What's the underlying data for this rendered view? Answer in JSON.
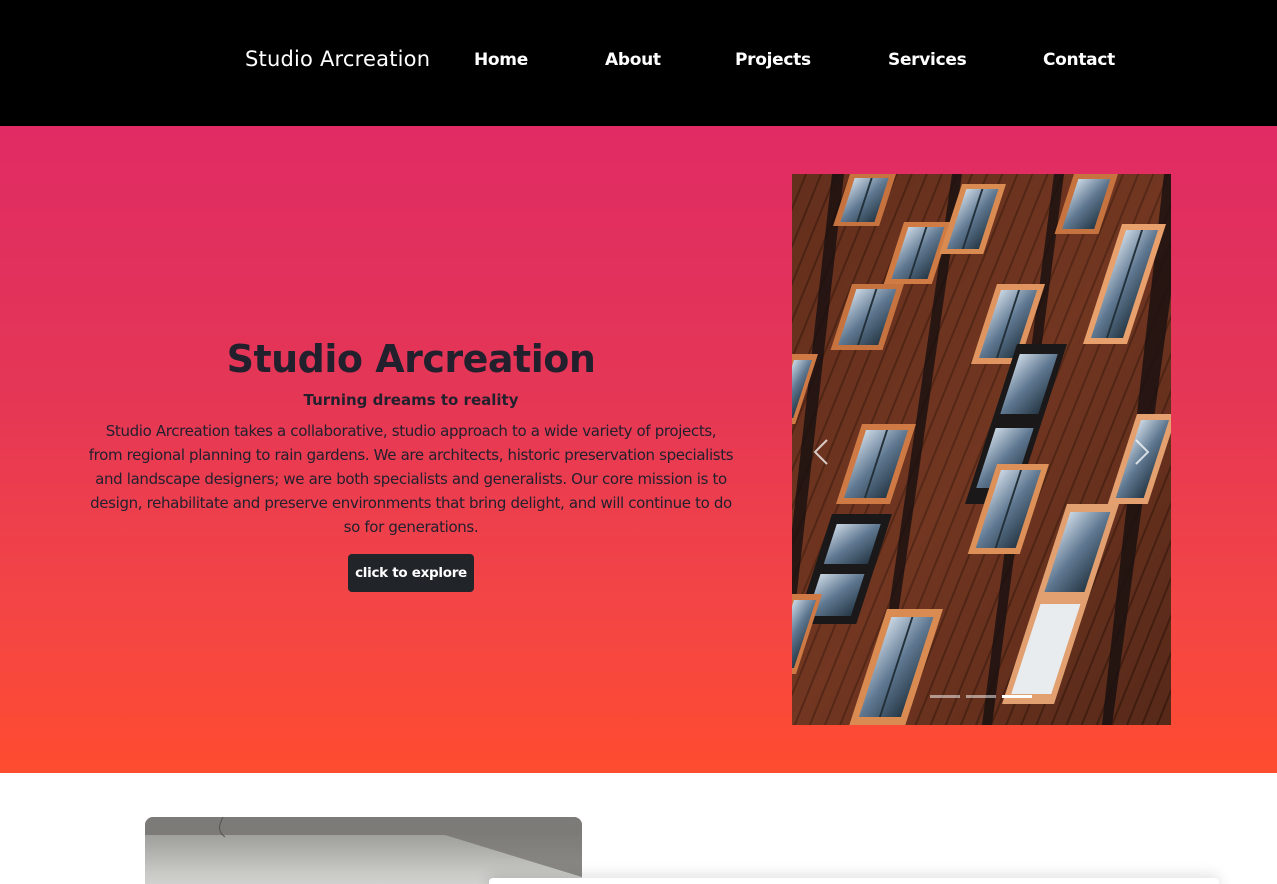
{
  "navbar": {
    "brand": "Studio Arcreation",
    "links": [
      "Home",
      "About",
      "Projects",
      "Services",
      "Contact"
    ]
  },
  "hero": {
    "title": "Studio Arcreation",
    "subtitle": "Turning dreams to reality",
    "description": "Studio Arcreation takes a collaborative, studio approach to a wide variety of projects, from regional planning to rain gardens. We are architects, historic preservation specialists and landscape designers; we are both specialists and generalists. Our core mission is to design, rehabilitate and preserve environments that bring delight, and will continue to do so for generations.",
    "button_label": "click to explore",
    "gradient_colors": [
      "#e02b64",
      "#fe4c2f"
    ]
  },
  "carousel": {
    "slide_count": 3,
    "active_index": 2,
    "prev_icon": "chevron-left-icon",
    "next_icon": "chevron-right-icon"
  },
  "colors": {
    "navbar_bg": "#000000",
    "text_dark": "#23202e",
    "button_bg": "#212529"
  }
}
